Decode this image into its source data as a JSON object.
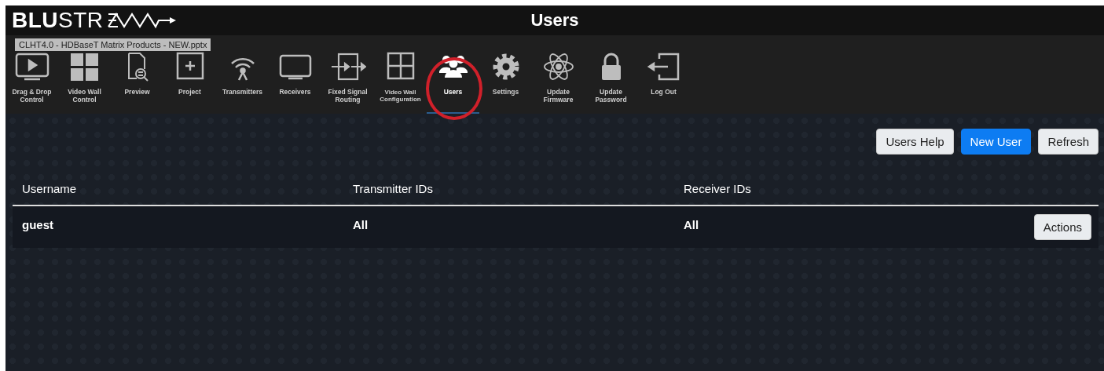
{
  "header": {
    "logo": "**BLU**STR",
    "title": "Users"
  },
  "tooltip": "CLHT4.0 - HDBaseT Matrix Products - NEW.pptx",
  "nav": [
    {
      "kind": "play",
      "label": "Drag & Drop\nControl",
      "selected": false
    },
    {
      "kind": "wall",
      "label": "Video Wall\nControl",
      "selected": false
    },
    {
      "kind": "preview",
      "label": "Preview",
      "selected": false
    },
    {
      "kind": "project",
      "label": "Project",
      "selected": false
    },
    {
      "kind": "antenna",
      "label": "Transmitters",
      "selected": false
    },
    {
      "kind": "screen",
      "label": "Receivers",
      "selected": false
    },
    {
      "kind": "routing",
      "label": "Fixed Signal\nRouting",
      "selected": false
    },
    {
      "kind": "grid",
      "label": "Video Wall\nConfiguration",
      "selected": false
    },
    {
      "kind": "users",
      "label": "Users",
      "selected": true
    },
    {
      "kind": "gear",
      "label": "Settings",
      "selected": false
    },
    {
      "kind": "atom",
      "label": "Update\nFirmware",
      "selected": false
    },
    {
      "kind": "lock",
      "label": "Update\nPassword",
      "selected": false
    },
    {
      "kind": "logout",
      "label": "Log Out",
      "selected": false
    }
  ],
  "toolbar": [
    {
      "kind": "light",
      "label": "Users Help"
    },
    {
      "kind": "primary",
      "label": "New User"
    },
    {
      "kind": "light",
      "label": "Refresh"
    }
  ],
  "table": {
    "columns": [
      "Username",
      "Transmitter IDs",
      "Receiver IDs"
    ],
    "rows": [
      {
        "cells": [
          "guest",
          "All",
          "All"
        ],
        "action": "Actions"
      }
    ]
  }
}
